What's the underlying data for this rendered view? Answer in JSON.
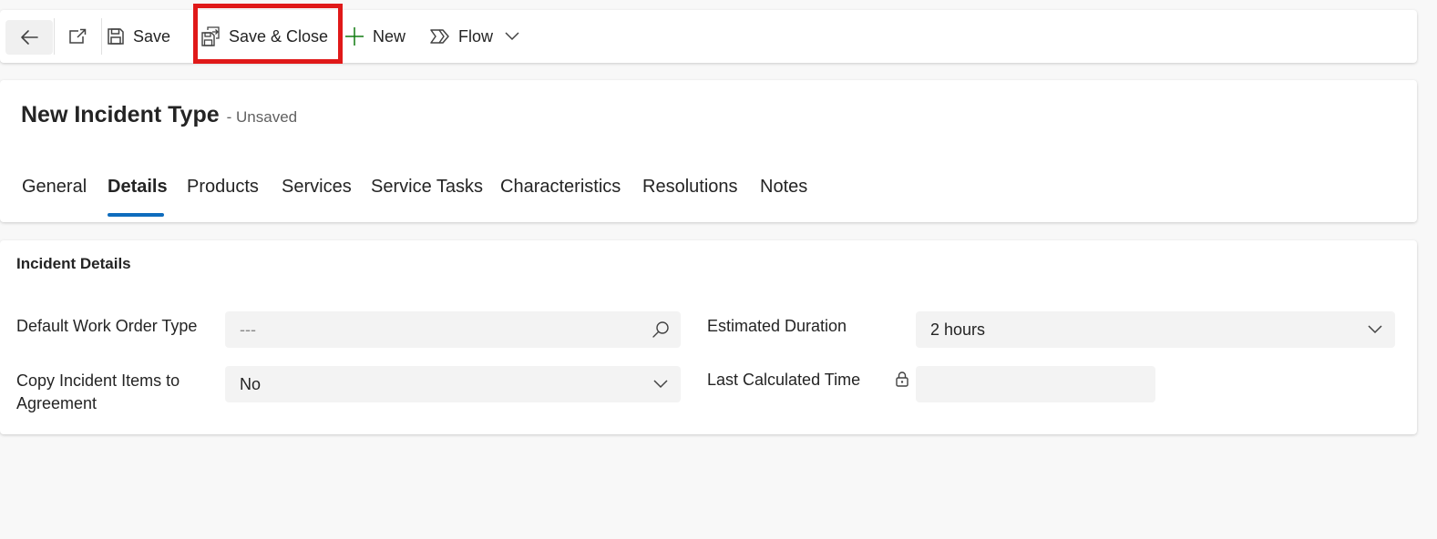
{
  "toolbar": {
    "back_icon": "arrow-left-icon",
    "popout_icon": "open-in-new-window-icon",
    "save_label": "Save",
    "save_icon": "floppy-disk-icon",
    "save_close_label": "Save & Close",
    "save_close_icon": "save-and-close-icon",
    "new_label": "New",
    "new_icon": "plus-icon",
    "flow_label": "Flow",
    "flow_icon": "flow-icon",
    "highlight_color": "#e01919"
  },
  "header": {
    "title": "New Incident Type",
    "status": "- Unsaved"
  },
  "tabs": [
    {
      "label": "General"
    },
    {
      "label": "Details",
      "active": true
    },
    {
      "label": "Products"
    },
    {
      "label": "Services"
    },
    {
      "label": "Service Tasks"
    },
    {
      "label": "Characteristics"
    },
    {
      "label": "Resolutions"
    },
    {
      "label": "Notes"
    }
  ],
  "section": {
    "title": "Incident Details",
    "fields": {
      "default_work_order_type": {
        "label": "Default Work Order Type",
        "value": "---",
        "icon": "search-icon"
      },
      "copy_incident_items": {
        "label": "Copy Incident Items to Agreement",
        "value": "No",
        "icon": "chevron-down-icon"
      },
      "estimated_duration": {
        "label": "Estimated Duration",
        "value": "2 hours",
        "icon": "chevron-down-icon"
      },
      "last_calculated_time": {
        "label": "Last Calculated Time",
        "value": "",
        "icon": "lock-icon"
      }
    }
  },
  "colors": {
    "accent": "#0f6cbd",
    "new_icon": "#107c10"
  }
}
